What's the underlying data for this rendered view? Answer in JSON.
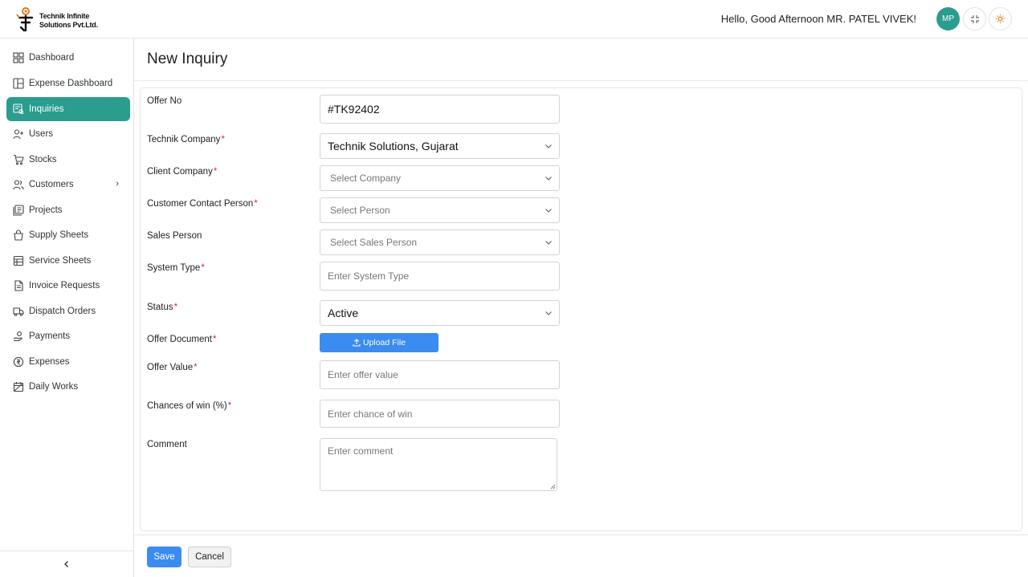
{
  "header": {
    "logo_line1": "Technik Infinite",
    "logo_line2": "Solutions Pvt.Ltd.",
    "greeting": "Hello, Good Afternoon MR. PATEL VIVEK!",
    "avatar_initials": "MP"
  },
  "sidebar": {
    "items": [
      {
        "label": "Dashboard",
        "icon": "grid-icon"
      },
      {
        "label": "Expense Dashboard",
        "icon": "layout-icon"
      },
      {
        "label": "Inquiries",
        "icon": "inquiry-icon",
        "active": true
      },
      {
        "label": "Users",
        "icon": "user-plus-icon"
      },
      {
        "label": "Stocks",
        "icon": "cart-icon"
      },
      {
        "label": "Customers",
        "icon": "users-icon",
        "has_children": true
      },
      {
        "label": "Projects",
        "icon": "projects-icon"
      },
      {
        "label": "Supply Sheets",
        "icon": "bag-icon"
      },
      {
        "label": "Service Sheets",
        "icon": "sheet-icon"
      },
      {
        "label": "Invoice Requests",
        "icon": "invoice-icon"
      },
      {
        "label": "Dispatch Orders",
        "icon": "truck-icon"
      },
      {
        "label": "Payments",
        "icon": "payment-icon"
      },
      {
        "label": "Expenses",
        "icon": "coin-icon"
      },
      {
        "label": "Daily Works",
        "icon": "calendar-icon"
      }
    ],
    "collapse_icon": "chevron-left-icon"
  },
  "page": {
    "title": "New Inquiry"
  },
  "form": {
    "offer_no": {
      "label": "Offer No",
      "value": "#TK92402"
    },
    "technik_company": {
      "label": "Technik Company",
      "value": "Technik Solutions, Gujarat"
    },
    "client_company": {
      "label": "Client Company",
      "placeholder": "Select Company"
    },
    "contact_person": {
      "label": "Customer Contact Person",
      "placeholder": "Select Person"
    },
    "sales_person": {
      "label": "Sales Person",
      "placeholder": "Select Sales Person"
    },
    "system_type": {
      "label": "System Type",
      "placeholder": "Enter System Type"
    },
    "status": {
      "label": "Status",
      "value": "Active"
    },
    "offer_document": {
      "label": "Offer Document",
      "button": "Upload File"
    },
    "offer_value": {
      "label": "Offer Value",
      "placeholder": "Enter offer value"
    },
    "chances_of_win": {
      "label": "Chances of win (%)",
      "placeholder": "Enter chance of win"
    },
    "comment": {
      "label": "Comment",
      "placeholder": "Enter comment"
    },
    "required_marker": "*"
  },
  "actions": {
    "save": "Save",
    "cancel": "Cancel"
  },
  "colors": {
    "accent": "#2a9d8f",
    "primary_button": "#3b8cf0",
    "required": "#d32f2f"
  }
}
